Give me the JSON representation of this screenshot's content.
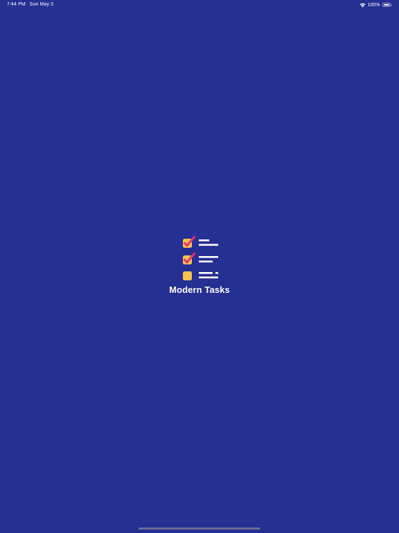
{
  "status_bar": {
    "time": "7:44 PM",
    "date": "Sun May 3",
    "battery_percent": "100%",
    "battery_level": 1.0
  },
  "splash": {
    "app_name": "Modern Tasks",
    "logo_icon": "checklist-icon",
    "checklist_states": [
      "checked",
      "checked",
      "unchecked"
    ]
  },
  "colors": {
    "background": "#262f92",
    "checkbox": "#f8c24d",
    "checkmark": "#ea2f6f",
    "text": "#ffffff"
  }
}
